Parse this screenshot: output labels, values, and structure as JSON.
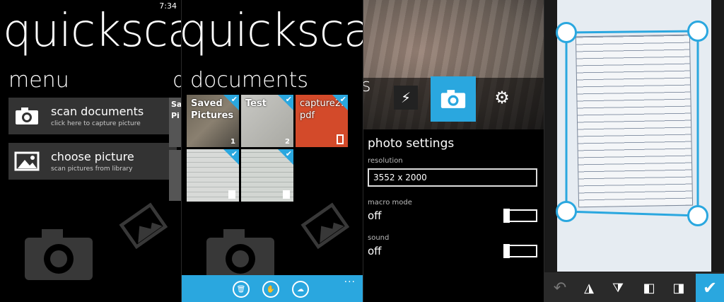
{
  "status": {
    "time": "7:34"
  },
  "app": {
    "name": "quickscan"
  },
  "menu_screen": {
    "title": "menu",
    "peek_title": "do",
    "peek_tile": "Sa Pi",
    "items": [
      {
        "label": "scan documents",
        "sublabel": "click here to capture picture",
        "icon": "camera-icon"
      },
      {
        "label": "choose picture",
        "sublabel": "scan pictures from library",
        "icon": "picture-icon"
      }
    ]
  },
  "documents_screen": {
    "title": "documents",
    "tiles": [
      {
        "title": "Saved Pictures",
        "count": "1",
        "kind": "folder"
      },
      {
        "title": "Test",
        "count": "2",
        "kind": "folder"
      },
      {
        "title": "capture2.pdf",
        "count": "",
        "kind": "pdf"
      },
      {
        "title": "",
        "count": "",
        "kind": "document"
      },
      {
        "title": "",
        "count": "",
        "kind": "document"
      }
    ],
    "appbar": {
      "buttons": [
        "delete-icon",
        "pdf-icon",
        "upload-icon"
      ],
      "more": "..."
    }
  },
  "camera_screen": {
    "peek_letter": "s",
    "settings_title": "photo settings",
    "resolution_label": "resolution",
    "resolution_value": "3552 x 2000",
    "macro_label": "macro mode",
    "macro_value": "off",
    "sound_label": "sound",
    "sound_value": "off",
    "icons": [
      "flash-off-icon",
      "camera-icon",
      "gear-icon"
    ]
  },
  "edit_screen": {
    "toolbar": [
      "undo-icon",
      "flip-vertical-icon",
      "flip-horizontal-icon",
      "rotate-left-icon",
      "rotate-right-icon",
      "confirm-icon"
    ]
  },
  "colors": {
    "accent": "#2aa7df",
    "pdf_tile": "#d34a2a",
    "tile_bg": "#333333"
  }
}
